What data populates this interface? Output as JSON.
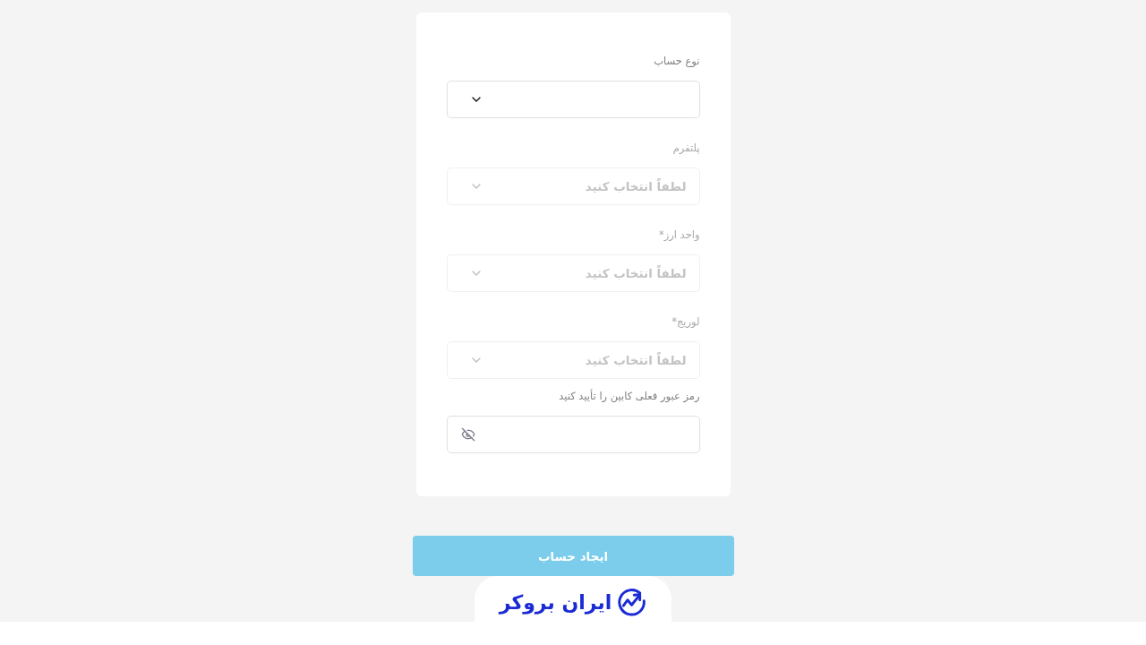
{
  "form": {
    "fields": [
      {
        "kind": "select",
        "label": "نوع حساب",
        "disabled": false
      },
      {
        "kind": "select",
        "label": "پلتفرم",
        "placeholder": "لطفاً انتخاب کنید",
        "disabled": true
      },
      {
        "kind": "select",
        "label": "واحد ارز*",
        "placeholder": "لطفاً انتخاب کنید",
        "disabled": true
      },
      {
        "kind": "select",
        "label": "لوریج*",
        "placeholder": "لطفاً انتخاب کنید",
        "disabled": true
      },
      {
        "kind": "password",
        "label": "رمز عبور فعلی کابین را تأیید کنید",
        "disabled": false
      }
    ]
  },
  "submit_button": {
    "label": "ایجاد حساب",
    "disabled": true
  },
  "footer": {
    "logo_text": "ایران بروکر"
  }
}
